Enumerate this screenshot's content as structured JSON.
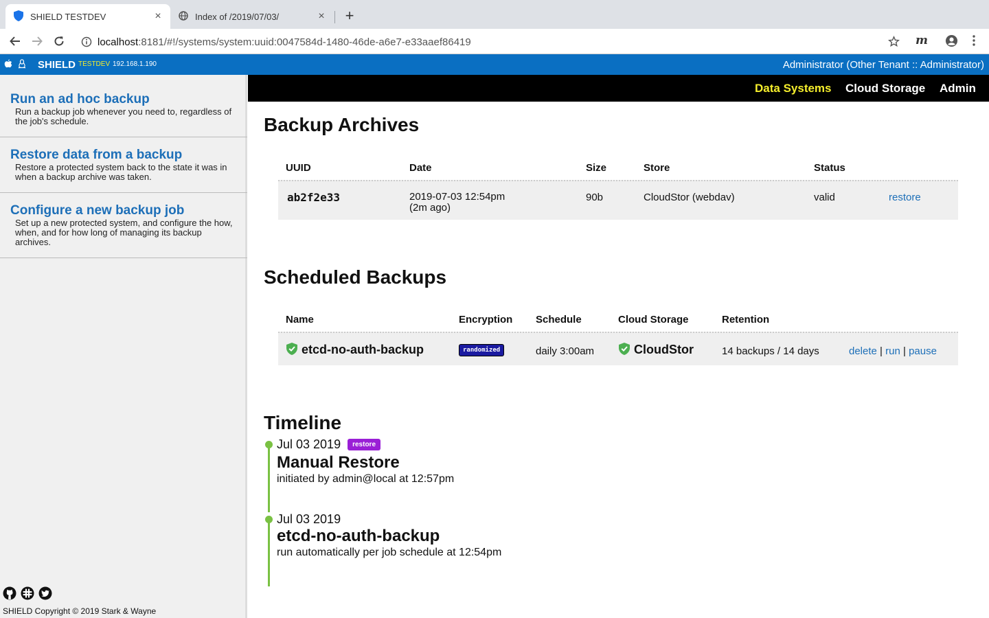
{
  "browser": {
    "tabs": [
      {
        "title": "SHIELD TESTDEV",
        "active": true
      },
      {
        "title": "Index of /2019/07/03/",
        "active": false
      }
    ],
    "url": {
      "host": "localhost",
      "rest": ":8181/#!/systems/system:uuid:0047584d-1480-46de-a6e7-e33aaef86419"
    },
    "extension_label": "m"
  },
  "header": {
    "brand": "SHIELD",
    "env": "TESTDEV",
    "ip": "192.168.1.190",
    "user": "Administrator (Other Tenant :: Administrator)"
  },
  "sidebar": {
    "items": [
      {
        "title": "Run an ad hoc backup",
        "desc": "Run a backup job whenever you need to, regardless of the job's schedule."
      },
      {
        "title": "Restore data from a backup",
        "desc": "Restore a protected system back to the state it was in when a backup archive was taken."
      },
      {
        "title": "Configure a new backup job",
        "desc": "Set up a new protected system, and configure the how, when, and for how long of managing its backup archives."
      }
    ],
    "copyright": "SHIELD Copyright © 2019 Stark & Wayne"
  },
  "nav": {
    "items": [
      "Data Systems",
      "Cloud Storage",
      "Admin"
    ],
    "active": "Data Systems"
  },
  "archives": {
    "heading": "Backup Archives",
    "columns": [
      "UUID",
      "Date",
      "Size",
      "Store",
      "Status"
    ],
    "rows": [
      {
        "uuid": "ab2f2e33",
        "date": "2019-07-03 12:54pm",
        "ago": "(2m ago)",
        "size": "90b",
        "store": "CloudStor (webdav)",
        "status": "valid",
        "action": "restore"
      }
    ]
  },
  "scheduled": {
    "heading": "Scheduled Backups",
    "columns": [
      "Name",
      "Encryption",
      "Schedule",
      "Cloud Storage",
      "Retention"
    ],
    "rows": [
      {
        "name": "etcd-no-auth-backup",
        "encryption": "randomized",
        "schedule": "daily 3:00am",
        "storage": "CloudStor",
        "retention": "14 backups / 14 days",
        "actions": [
          "delete",
          "run",
          "pause"
        ],
        "separator": "|"
      }
    ]
  },
  "timeline": {
    "heading": "Timeline",
    "events": [
      {
        "date": "Jul 03 2019",
        "badge": "restore",
        "title": "Manual Restore",
        "desc": "initiated by admin@local at 12:57pm"
      },
      {
        "date": "Jul 03 2019",
        "badge": "",
        "title": "etcd-no-auth-backup",
        "desc": "run automatically per job schedule at 12:54pm"
      }
    ]
  },
  "colors": {
    "appbar": "#0a6fc2",
    "nav_active": "#f5ee2c",
    "link": "#1d6fb8",
    "timeline": "#7ac143",
    "restore_badge": "#9a1fd6",
    "encryption_badge": "#1a1aa0"
  },
  "icons": [
    "shield-icon",
    "globe-icon",
    "close-icon",
    "plus-icon",
    "back-arrow-icon",
    "forward-arrow-icon",
    "reload-icon",
    "info-icon",
    "star-icon",
    "profile-icon",
    "kebab-menu-icon",
    "apple-icon",
    "linux-icon",
    "github-icon",
    "slack-icon",
    "twitter-icon",
    "check-shield-icon"
  ]
}
